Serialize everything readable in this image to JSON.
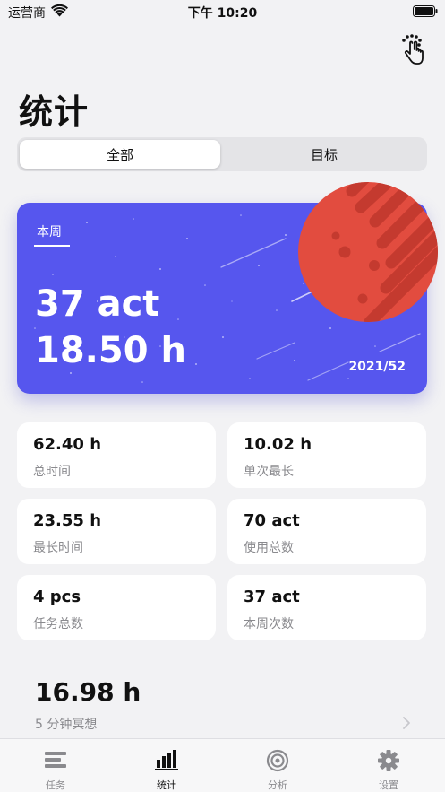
{
  "status_bar": {
    "carrier": "运营商",
    "time": "下午 10:20"
  },
  "page_title": "统计",
  "segments": [
    {
      "label": "全部",
      "active": true
    },
    {
      "label": "目标",
      "active": false
    }
  ],
  "week_card": {
    "tab": "本周",
    "count": "37 act",
    "hours": "18.50 h",
    "week_id": "2021/52",
    "background_color": "#5656ee",
    "planet_color": "#e24c3f"
  },
  "stats": [
    {
      "value": "62.40 h",
      "label": "总时间"
    },
    {
      "value": "10.02 h",
      "label": "单次最长"
    },
    {
      "value": "23.55 h",
      "label": "最长时间"
    },
    {
      "value": "70 act",
      "label": "使用总数"
    },
    {
      "value": "4 pcs",
      "label": "任务总数"
    },
    {
      "value": "37 act",
      "label": "本周次数"
    }
  ],
  "meditation": {
    "value": "16.98 h",
    "label": "5 分钟冥想"
  },
  "tab_bar": [
    {
      "label": "任务",
      "icon": "tasks-icon",
      "active": false
    },
    {
      "label": "统计",
      "icon": "bar-chart-icon",
      "active": true
    },
    {
      "label": "分析",
      "icon": "analysis-icon",
      "active": false
    },
    {
      "label": "设置",
      "icon": "gear-icon",
      "active": false
    }
  ]
}
